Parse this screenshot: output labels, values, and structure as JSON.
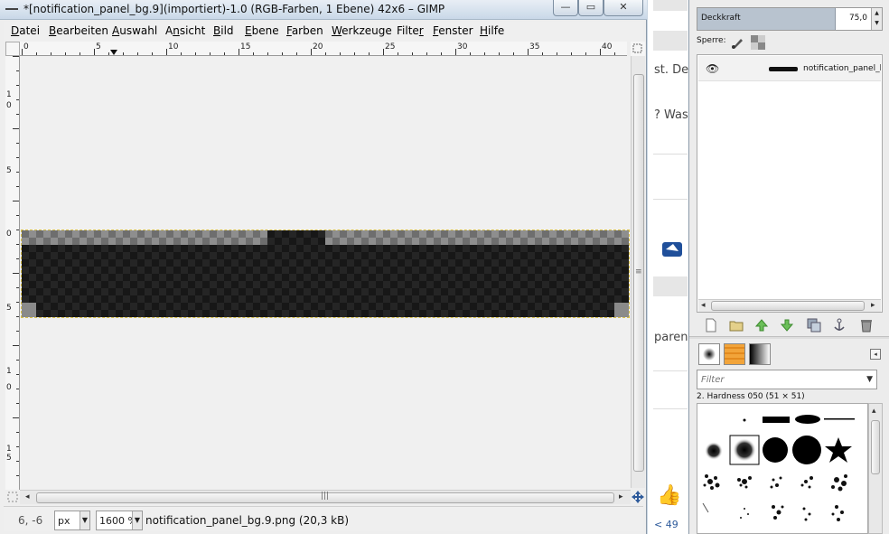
{
  "window": {
    "title": "*[notification_panel_bg.9](importiert)-1.0 (RGB-Farben, 1 Ebene) 42x6 – GIMP",
    "min_glyph": "—",
    "max_glyph": "▭",
    "close_glyph": "✕"
  },
  "menu": {
    "items": [
      {
        "pre": "",
        "u": "D",
        "post": "atei"
      },
      {
        "pre": "",
        "u": "B",
        "post": "earbeiten"
      },
      {
        "pre": "",
        "u": "A",
        "post": "uswahl"
      },
      {
        "pre": "A",
        "u": "n",
        "post": "sicht"
      },
      {
        "pre": "",
        "u": "B",
        "post": "ild"
      },
      {
        "pre": "",
        "u": "E",
        "post": "bene"
      },
      {
        "pre": "",
        "u": "F",
        "post": "arben"
      },
      {
        "pre": "",
        "u": "W",
        "post": "erkzeuge"
      },
      {
        "pre": "Filte",
        "u": "r",
        "post": ""
      },
      {
        "pre": "",
        "u": "F",
        "post": "enster"
      },
      {
        "pre": "",
        "u": "H",
        "post": "ilfe"
      }
    ]
  },
  "rulers": {
    "horizontal_labels": [
      "0",
      "5",
      "10",
      "15",
      "20",
      "25",
      "30",
      "35",
      "40"
    ],
    "vertical_labels": [
      "1",
      "0",
      "5",
      "0",
      "5",
      "1",
      "0",
      "1",
      "5"
    ]
  },
  "status": {
    "coords": "6, -6",
    "unit": "px",
    "zoom": "1600 %",
    "file_info": "notification_panel_bg.9.png (20,3 kB)"
  },
  "background_window": {
    "texts": [
      "st. De",
      "? Was",
      "paren",
      "< 49"
    ]
  },
  "layers_panel": {
    "opacity_label": "Deckkraft",
    "opacity_value": "75,0",
    "opacity_fraction": 0.75,
    "lock_label": "Sperre:",
    "layer_name": "notification_panel_bg"
  },
  "brushes_panel": {
    "filter_placeholder": "Filter",
    "selected_brush": "2. Hardness 050 (51 × 51)"
  },
  "colors": {
    "accent": "#b8c3cf",
    "selection": "#d8c04a"
  }
}
